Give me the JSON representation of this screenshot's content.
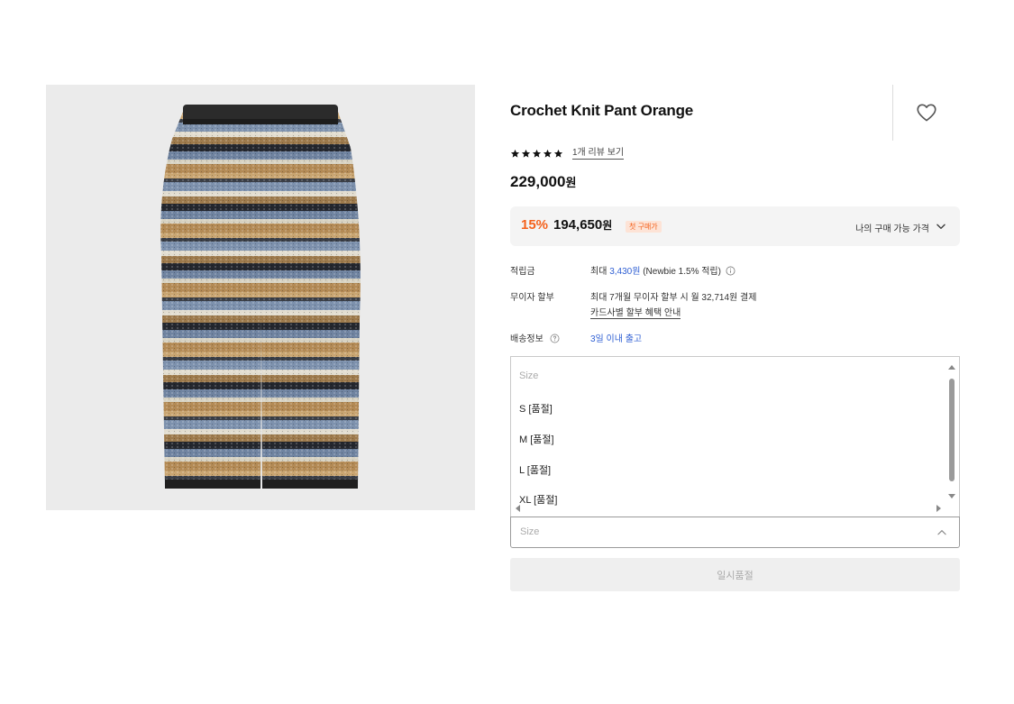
{
  "product": {
    "title": "Crochet Knit Pant Orange",
    "image_alt": "crochet-knit-pant-photo",
    "rating_stars": 5,
    "review_link": "1개 리뷰 보기",
    "price": "229,000",
    "price_unit": "원"
  },
  "discount": {
    "percent": "15%",
    "price": "194,650",
    "price_unit": "원",
    "badge": "첫 구매가",
    "my_price_label": "나의 구매 가능 가격",
    "accent_color": "#f4611c"
  },
  "info": {
    "points_label": "적립금",
    "points_prefix": "최대",
    "points_amount": "3,430원",
    "points_suffix": "(Newbie 1.5% 적립)",
    "installment_label": "무이자 할부",
    "installment_text": "최대 7개월 무이자 할부 시 월 32,714원 결제",
    "installment_link": "카드사별 할부 혜택 안내",
    "shipping_label": "배송정보",
    "shipping_value": "3일 이내 출고"
  },
  "size_options": {
    "placeholder": "Size",
    "options": [
      "S [품절]",
      "M [품절]",
      "L [품절]",
      "XL [품절]"
    ]
  },
  "size_select": {
    "placeholder": "Size"
  },
  "soldout_button": {
    "label": "일시품절"
  },
  "icons": {
    "wishlist": "heart-icon",
    "star": "star-icon",
    "dropdown": "chevron-down-icon",
    "info": "info-circle-icon",
    "help": "question-circle-icon",
    "collapse": "chevron-up-icon"
  }
}
